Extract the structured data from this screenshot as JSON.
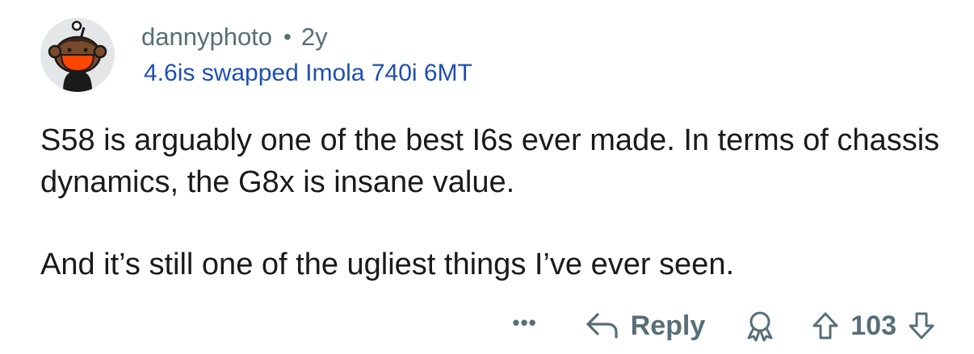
{
  "comment": {
    "username": "dannyphoto",
    "separator": "•",
    "age": "2y",
    "flair": "4.6is swapped Imola 740i 6MT",
    "paragraphs": [
      "S58 is arguably one of the best I6s ever made. In terms of chassis dynamics, the G8x is insane value.",
      "And it’s still one of the ugliest things I’ve ever seen."
    ],
    "avatar_icon": "snoo-avatar-icon"
  },
  "actions": {
    "more_label": "•••",
    "reply_label": "Reply",
    "reply_icon": "reply-arrow-icon",
    "award_icon": "award-icon",
    "upvote_icon": "upvote-arrow-icon",
    "downvote_icon": "downvote-arrow-icon",
    "vote_count": "103"
  },
  "colors": {
    "meta_text": "#576f76",
    "flair_text": "#1f4fb4",
    "body_text": "#1a1a1b",
    "avatar_bg": "#e4e6e8",
    "avatar_mask": "#ff4500"
  }
}
